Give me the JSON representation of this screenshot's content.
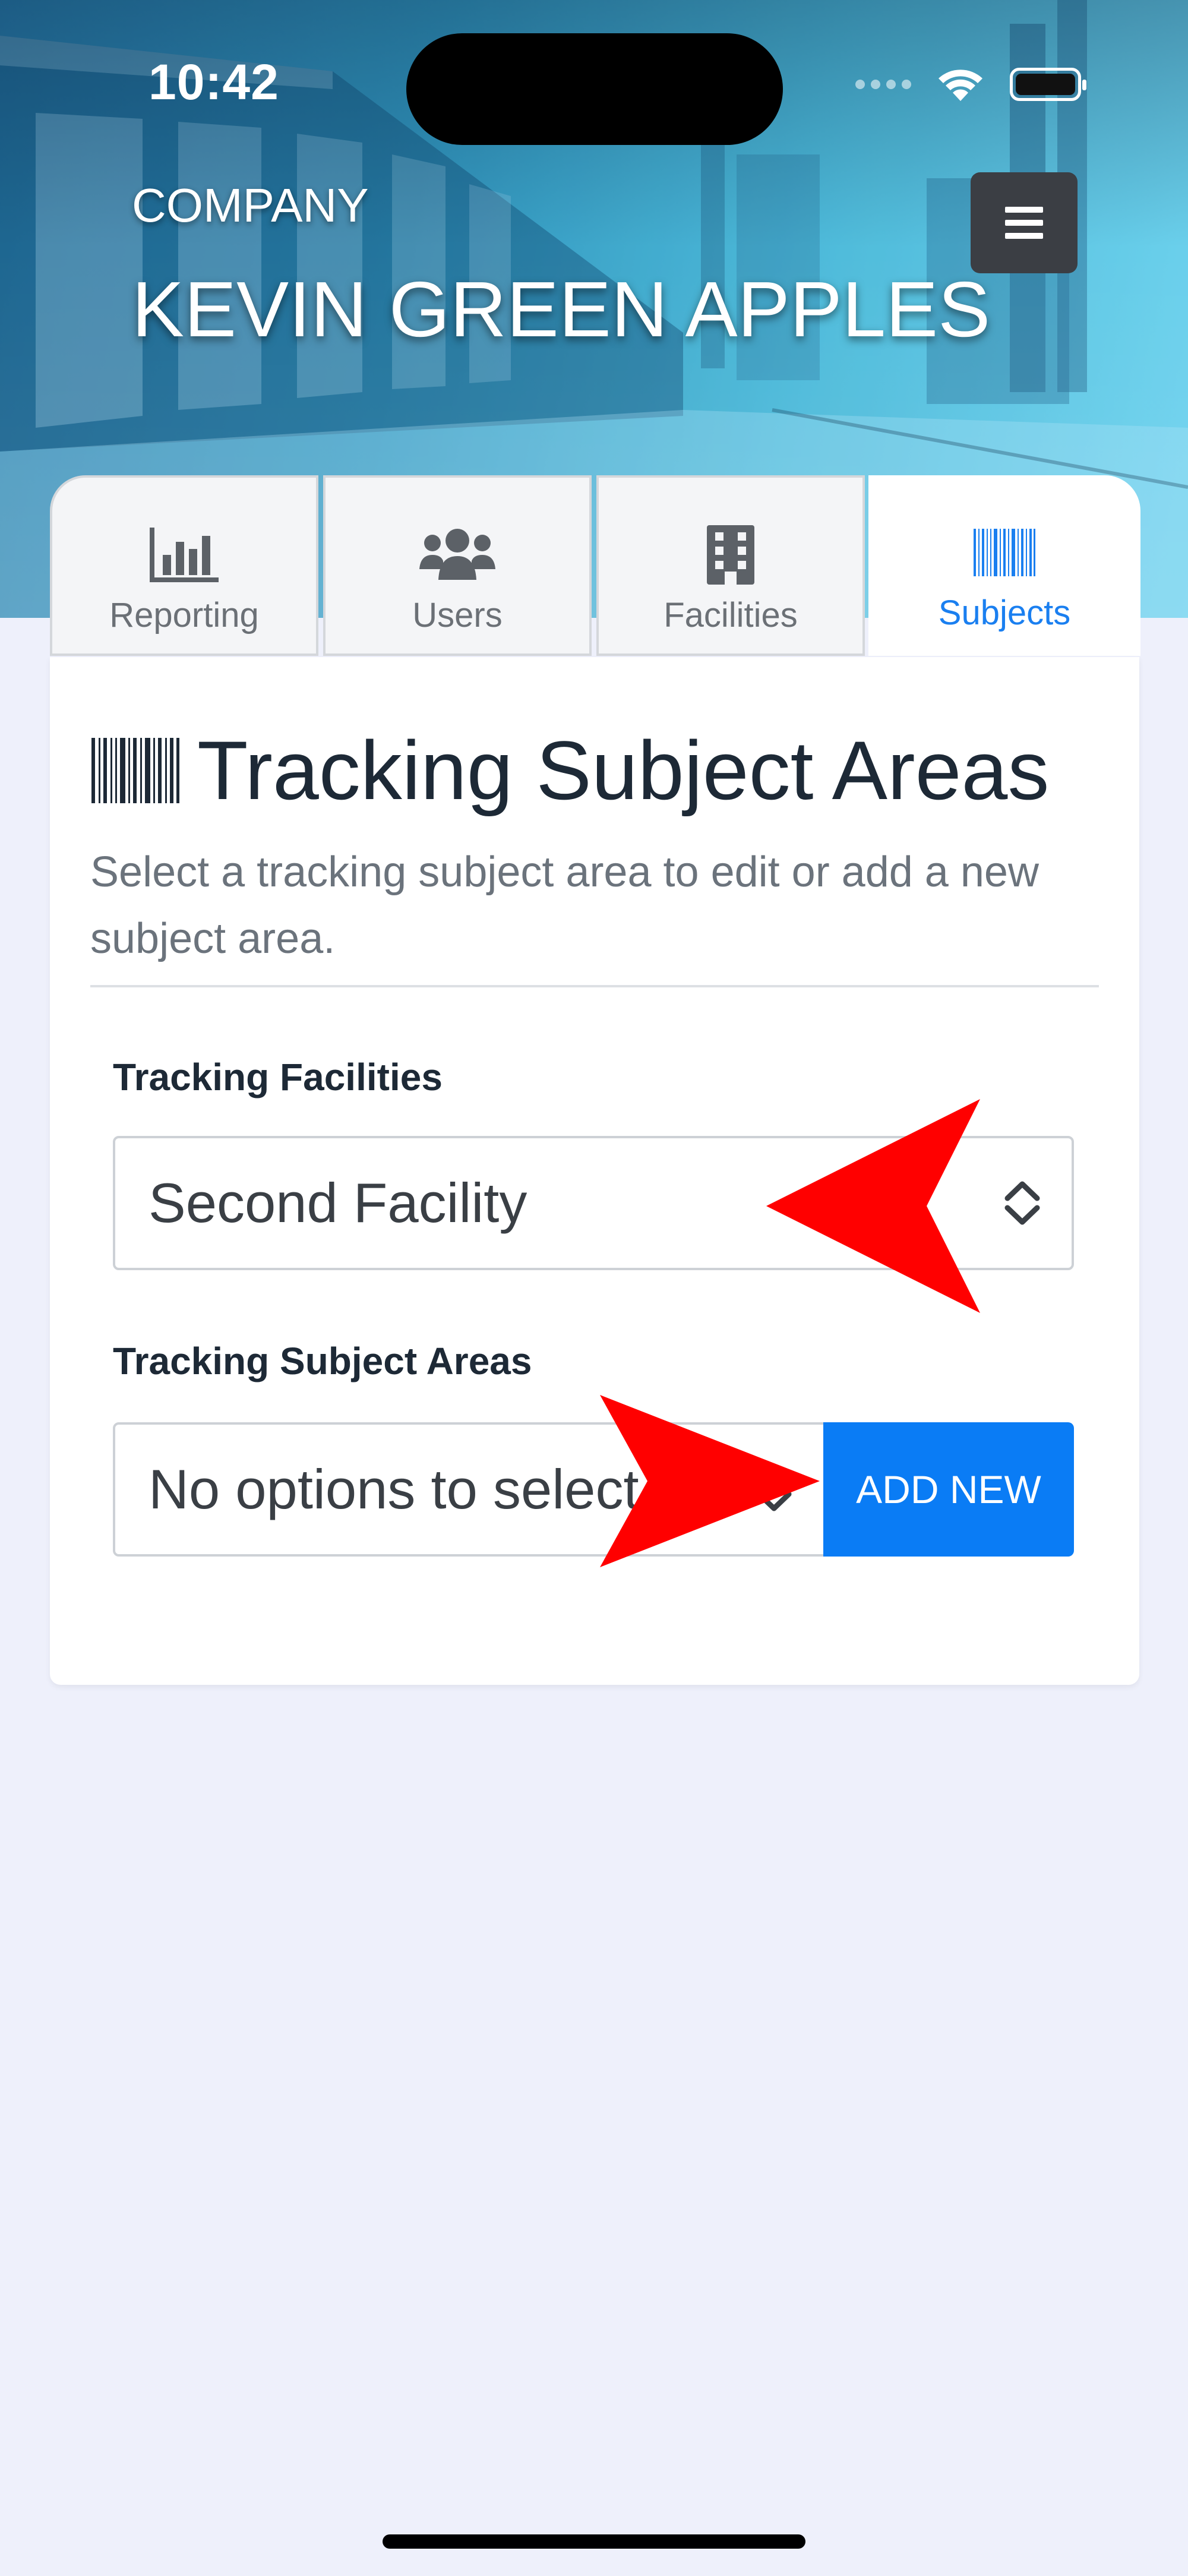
{
  "status_bar": {
    "time": "10:42"
  },
  "header": {
    "company_label": "COMPANY",
    "company_name": "KEVIN GREEN APPLES",
    "menu_icon": "hamburger-icon"
  },
  "tabs": [
    {
      "label": "Reporting",
      "icon": "bar-chart-icon",
      "active": false
    },
    {
      "label": "Users",
      "icon": "users-icon",
      "active": false
    },
    {
      "label": "Facilities",
      "icon": "building-icon",
      "active": false
    },
    {
      "label": "Subjects",
      "icon": "barcode-icon",
      "active": true
    }
  ],
  "page": {
    "title": "Tracking Subject Areas",
    "description": "Select a tracking subject area to edit or add a new subject area.",
    "facilities_label": "Tracking Facilities",
    "facilities_value": "Second Facility",
    "subject_areas_label": "Tracking Subject Areas",
    "subject_areas_value": "No options to select",
    "add_new_label": "ADD NEW"
  },
  "colors": {
    "accent": "#0a7cf5",
    "active_tab": "#1a7ff0",
    "annotation_arrow": "#ff0000",
    "page_background": "#eef0fb"
  }
}
